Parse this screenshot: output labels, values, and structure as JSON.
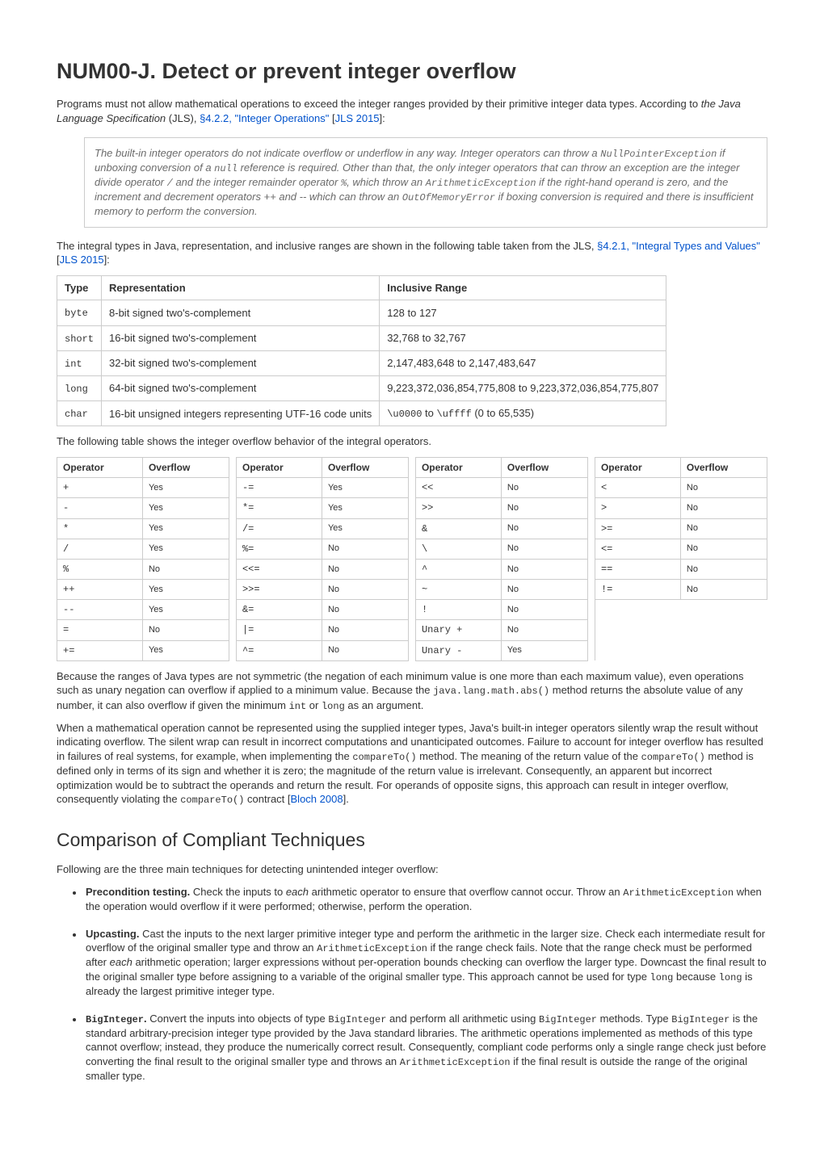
{
  "title": "NUM00-J. Detect or prevent integer overflow",
  "intro_pre": "Programs must not allow mathematical operations to exceed the integer ranges provided by their primitive integer data types. According to ",
  "intro_em": "the Java Language Specification",
  "intro_post1": " (JLS), ",
  "link_422": "§4.2.2, \"Integer Operations\"",
  "intro_post2": " [",
  "link_jls1": "JLS 2015",
  "intro_post3": "]:",
  "quote": {
    "t1": "The built-in integer operators do not indicate overflow or underflow in any way. Integer operators can throw a ",
    "c1": "NullPointerException",
    "t2": " if unboxing conversion of a ",
    "c2": "null",
    "t3": " reference is required. Other than that, the only integer operators that can throw an exception are the integer divide operator ",
    "c3": "/",
    "t4": " and the integer remainder operator ",
    "c4": "%",
    "t5": ", which throw an ",
    "c5": "ArithmeticException",
    "t6": " if the right-hand operand is zero, and the increment and decrement operators ++ and -- which can throw an ",
    "c6": "OutOfMemoryError",
    "t7": " if boxing conversion is required and there is insufficient memory to perform the conversion."
  },
  "after_quote": {
    "t1": "The integral types in Java, representation, and inclusive ranges are shown in the following table taken from the JLS, ",
    "link_421": "§4.2.1, \"Integral Types and Values\"",
    "t2": " [",
    "link_jls2": "JLS 2015",
    "t3": "]:"
  },
  "types_header": {
    "c1": "Type",
    "c2": "Representation",
    "c3": "Inclusive Range"
  },
  "types": [
    {
      "t": "byte",
      "r": "8-bit signed two's-complement",
      "range": "128 to 127"
    },
    {
      "t": "short",
      "r": "16-bit signed two's-complement",
      "range": "32,768 to 32,767"
    },
    {
      "t": "int",
      "r": "32-bit signed two's-complement",
      "range": "2,147,483,648 to 2,147,483,647"
    },
    {
      "t": "long",
      "r": "64-bit signed two's-complement",
      "range": "9,223,372,036,854,775,808 to 9,223,372,036,854,775,807"
    },
    {
      "t": "char",
      "r": "16-bit unsigned integers representing UTF-16 code units",
      "range_html": "<span class='mono'>\\u0000</span> to <span class='mono'>\\uffff</span> (0 to 65,535)"
    }
  ],
  "ops_intro": "The following table shows the integer overflow behavior of the integral operators.",
  "ops_header": {
    "op": "Operator",
    "ov": "Overflow"
  },
  "ops": [
    [
      {
        "o": "+",
        "v": "Yes"
      },
      {
        "o": "-=",
        "v": "Yes"
      },
      {
        "o": "<<",
        "v": "No"
      },
      {
        "o": "<",
        "v": "No"
      }
    ],
    [
      {
        "o": "-",
        "v": "Yes"
      },
      {
        "o": "*=",
        "v": "Yes"
      },
      {
        "o": ">>",
        "v": "No"
      },
      {
        "o": ">",
        "v": "No"
      }
    ],
    [
      {
        "o": "*",
        "v": "Yes"
      },
      {
        "o": "/=",
        "v": "Yes"
      },
      {
        "o": "&",
        "v": "No"
      },
      {
        "o": ">=",
        "v": "No"
      }
    ],
    [
      {
        "o": "/",
        "v": "Yes"
      },
      {
        "o": "%=",
        "v": "No"
      },
      {
        "o": "\\",
        "v": "No"
      },
      {
        "o": "<=",
        "v": "No"
      }
    ],
    [
      {
        "o": "%",
        "v": "No"
      },
      {
        "o": "<<=",
        "v": "No"
      },
      {
        "o": "^",
        "v": "No"
      },
      {
        "o": "==",
        "v": "No"
      }
    ],
    [
      {
        "o": "++",
        "v": "Yes"
      },
      {
        "o": ">>=",
        "v": "No"
      },
      {
        "o": "~",
        "v": "No"
      },
      {
        "o": "!=",
        "v": "No"
      }
    ],
    [
      {
        "o": "--",
        "v": "Yes"
      },
      {
        "o": "&=",
        "v": "No"
      },
      {
        "o": "!",
        "v": "No"
      },
      null
    ],
    [
      {
        "o": "=",
        "v": "No"
      },
      {
        "o": "|=",
        "v": "No"
      },
      {
        "o": "Unary +",
        "v": "No"
      },
      null
    ],
    [
      {
        "o": "+=",
        "v": "Yes"
      },
      {
        "o": "^=",
        "v": "No"
      },
      {
        "o": "Unary -",
        "v": "Yes"
      },
      null
    ]
  ],
  "para_sym": {
    "t1": "Because the ranges of Java types are not symmetric (the negation of each minimum value is one more than each maximum value), even operations such as unary negation can overflow if applied to a minimum value. Because the ",
    "c1": "java.lang.math.abs()",
    "t2": " method returns the absolute value of any number, it can also overflow if given the minimum ",
    "c2": "int",
    "t3": " or ",
    "c3": "long",
    "t4": " as an argument."
  },
  "para_wrap": {
    "t1": "When a mathematical operation cannot be represented using the supplied integer types, Java's built-in integer operators silently wrap the result without indicating overflow. The silent wrap can result in incorrect computations and unanticipated outcomes. Failure to account for integer overflow has resulted in failures of real systems, for example, when implementing the ",
    "c1": "compareTo()",
    "t2": " method. The meaning of the return value of the ",
    "c2": "compareTo()",
    "t3": " method is defined only in terms of its sign and whether it is zero; the magnitude of the return value is irrelevant. Consequently, an apparent but incorrect optimization would be to subtract the operands and return the result. For operands of opposite signs, this approach can result in integer overflow, consequently violating the ",
    "c3": "compareTo()",
    "t4": " contract [",
    "link_bloch": "Bloch 2008",
    "t5": "]."
  },
  "h2": "Comparison of Compliant Techniques",
  "tech_intro": "Following are the three main techniques for detecting unintended integer overflow:",
  "tech": {
    "pre": {
      "b": "Precondition testing.",
      "t1": " Check the inputs to ",
      "e1": "each",
      "t2": " arithmetic operator to ensure that overflow cannot occur. Throw an ",
      "c1": "ArithmeticException",
      "t3": " when the operation would overflow if it were performed; otherwise, perform the operation."
    },
    "up": {
      "b": "Upcasting.",
      "t1": " Cast the inputs to the next larger primitive integer type and perform the arithmetic in the larger size. Check each intermediate result for overflow of the original smaller type and throw an ",
      "c1": "ArithmeticException",
      "t2": " if the range check fails. Note that the range check must be performed after ",
      "e1": "each",
      "t3": " arithmetic operation; larger expressions without per-operation bounds checking can overflow the larger type. Downcast the final result to the original smaller type before assigning to a variable of the original smaller type. This approach cannot be used for type ",
      "c2": "long",
      "t4": " because ",
      "c3": "long",
      "t5": " is already the largest primitive integer type."
    },
    "big": {
      "bc": "BigInteger",
      "bdot": ".",
      "t1": " Convert the inputs into objects of type ",
      "c1": "BigInteger",
      "t2": " and perform all arithmetic using ",
      "c2": "BigInteger",
      "t3": " methods. Type ",
      "c3": "BigInteger",
      "t4": " is the standard arbitrary-precision integer type provided by the Java standard libraries. The arithmetic operations implemented as methods of this type cannot overflow; instead, they produce the numerically correct result. Consequently, compliant code performs only a single range check just before converting the final result to the original smaller type and throws an ",
      "c4": "ArithmeticException",
      "t5": " if the final result is outside the range of the original smaller type."
    }
  }
}
